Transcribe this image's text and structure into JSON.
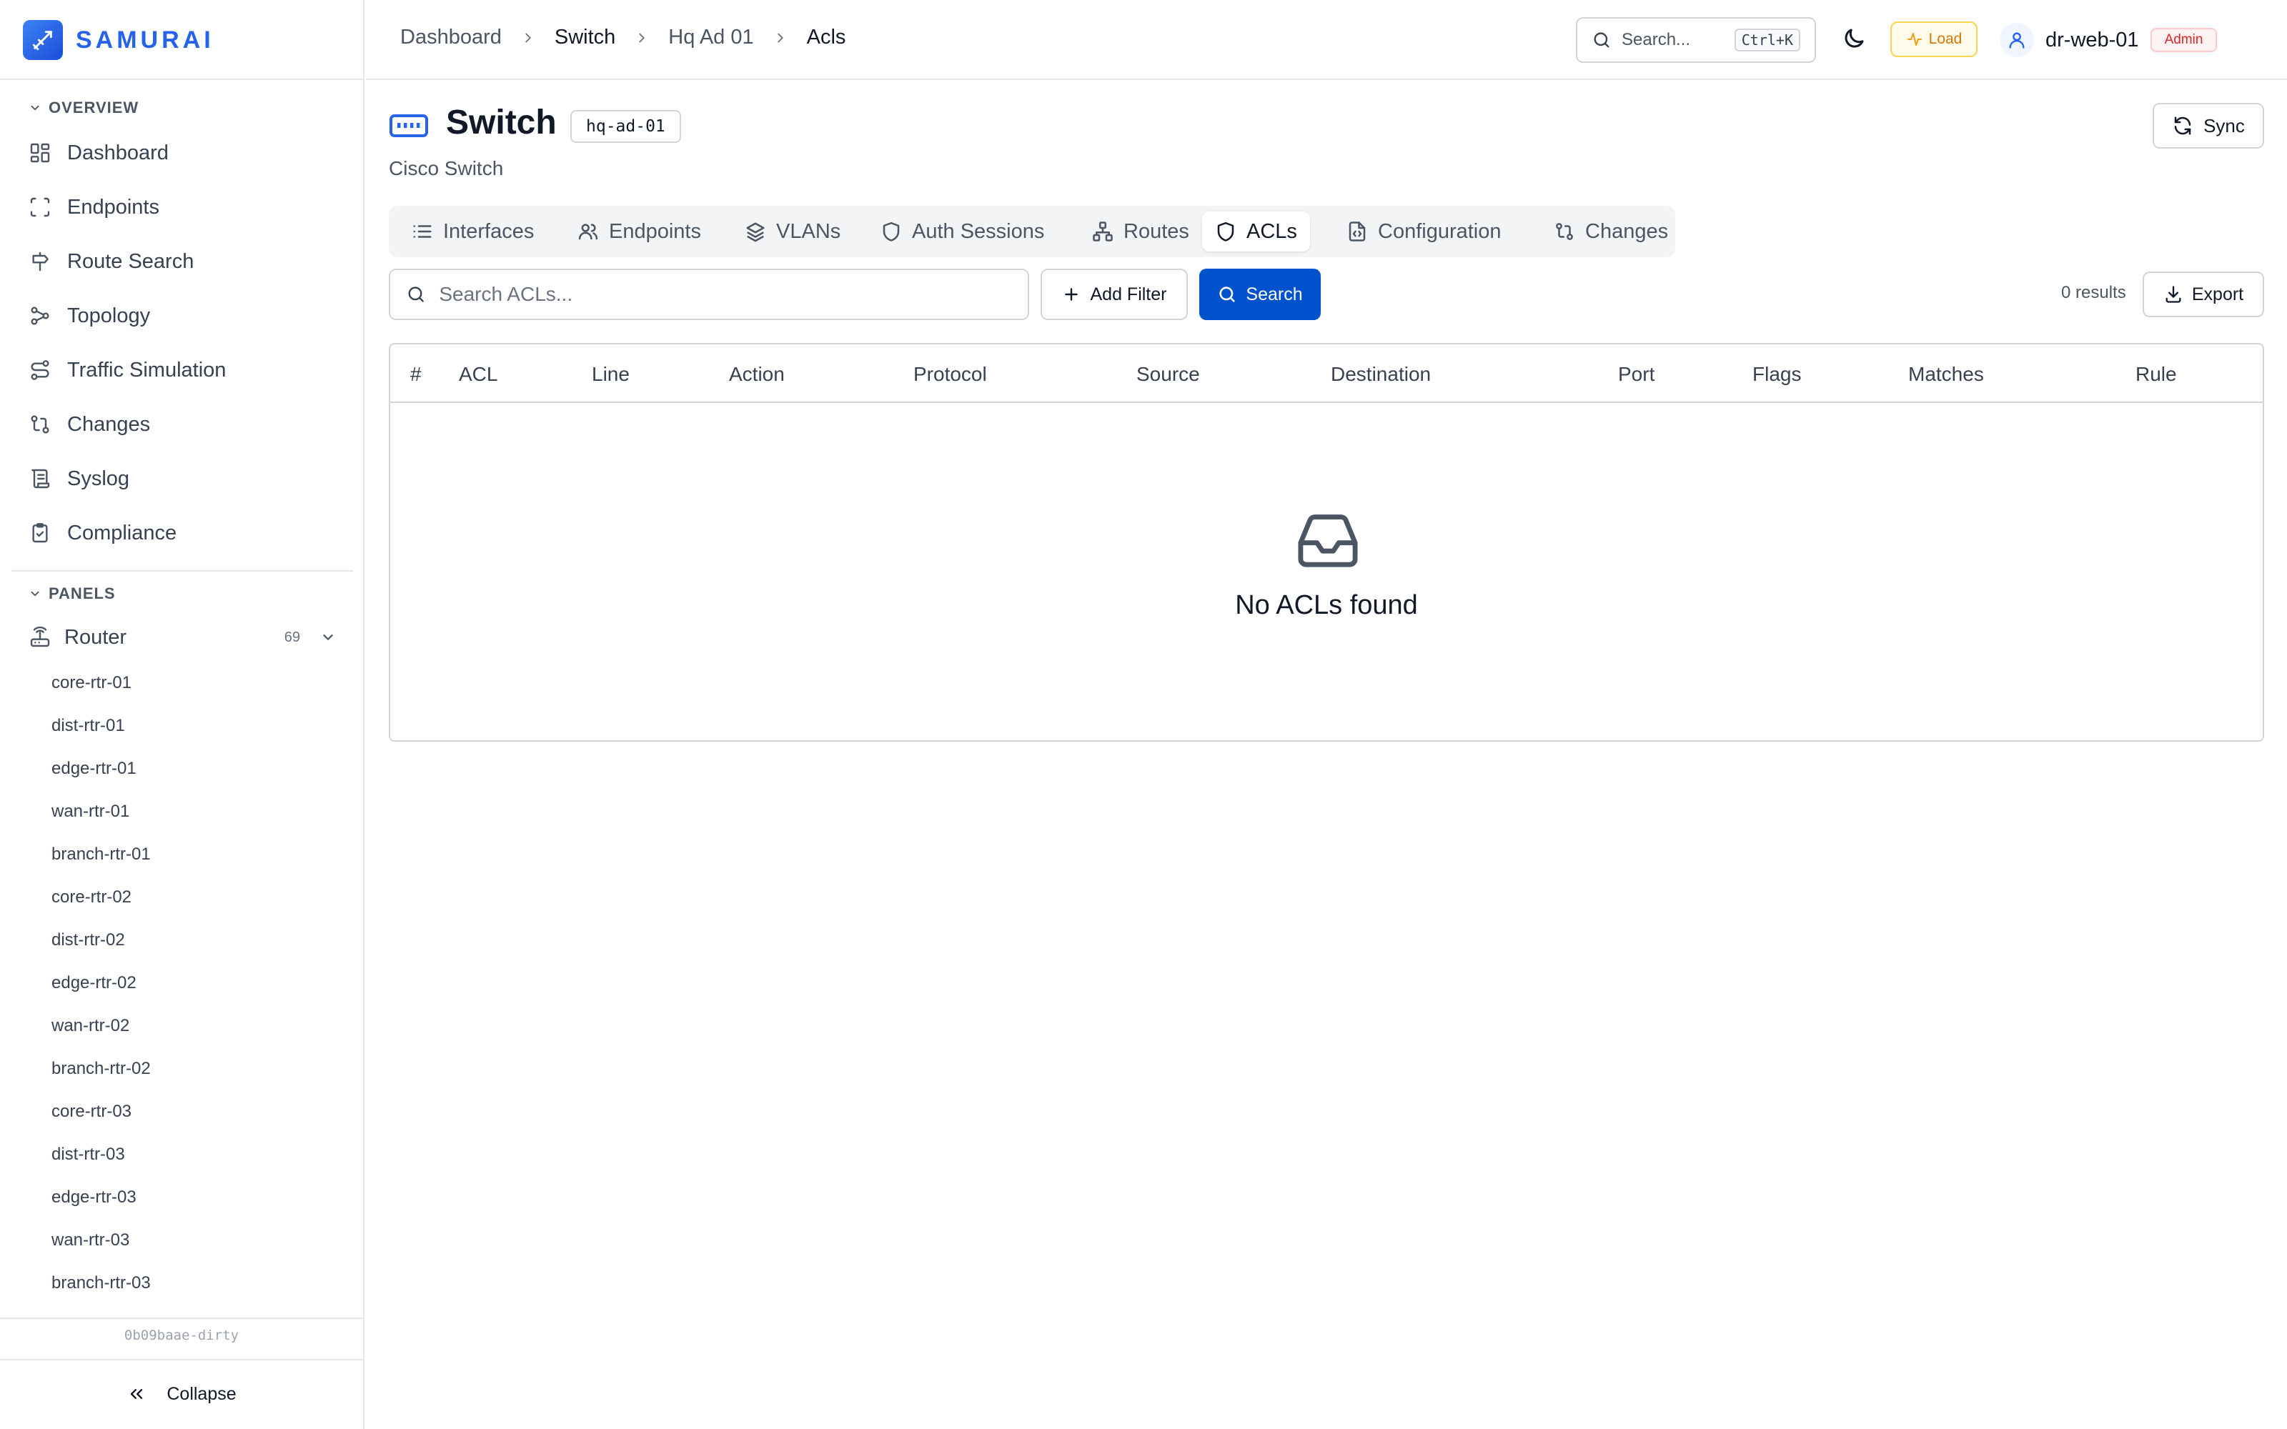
{
  "brand": {
    "name": "SAMURAI"
  },
  "sidebar": {
    "overview_label": "OVERVIEW",
    "nav": [
      {
        "label": "Dashboard",
        "icon": "grid-icon"
      },
      {
        "label": "Endpoints",
        "icon": "scan-icon"
      },
      {
        "label": "Route Search",
        "icon": "signpost-icon"
      },
      {
        "label": "Topology",
        "icon": "workflow-icon"
      },
      {
        "label": "Traffic Simulation",
        "icon": "route-icon"
      },
      {
        "label": "Changes",
        "icon": "git-compare-icon"
      },
      {
        "label": "Syslog",
        "icon": "scroll-icon"
      },
      {
        "label": "Compliance",
        "icon": "clipboard-check-icon"
      }
    ],
    "panels_label": "PANELS",
    "router_group": {
      "label": "Router",
      "count": "69"
    },
    "routers": [
      "core-rtr-01",
      "dist-rtr-01",
      "edge-rtr-01",
      "wan-rtr-01",
      "branch-rtr-01",
      "core-rtr-02",
      "dist-rtr-02",
      "edge-rtr-02",
      "wan-rtr-02",
      "branch-rtr-02",
      "core-rtr-03",
      "dist-rtr-03",
      "edge-rtr-03",
      "wan-rtr-03",
      "branch-rtr-03"
    ],
    "build_id": "0b09baae-dirty",
    "collapse_label": "Collapse"
  },
  "header": {
    "breadcrumb": [
      "Dashboard",
      "Switch",
      "Hq Ad 01",
      "Acls"
    ],
    "search_placeholder": "Search...",
    "search_shortcut": "Ctrl+K",
    "load_label": "Load",
    "username": "dr-web-01",
    "role": "Admin"
  },
  "page": {
    "title": "Switch",
    "hostname": "hq-ad-01",
    "subtitle": "Cisco Switch",
    "sync_label": "Sync"
  },
  "tabs": [
    {
      "label": "Interfaces",
      "icon": "list-icon",
      "active": false
    },
    {
      "label": "Endpoints",
      "icon": "users-icon",
      "active": false
    },
    {
      "label": "VLANs",
      "icon": "layers-icon",
      "active": false
    },
    {
      "label": "Auth Sessions",
      "icon": "shield-icon",
      "active": false
    },
    {
      "label": "Routes",
      "icon": "network-icon",
      "active": false
    },
    {
      "label": "ACLs",
      "icon": "shield-icon",
      "active": true
    },
    {
      "label": "Configuration",
      "icon": "file-code-icon",
      "active": false
    },
    {
      "label": "Changes",
      "icon": "git-compare-icon",
      "active": false
    }
  ],
  "toolbar": {
    "search_placeholder": "Search ACLs...",
    "add_filter_label": "Add Filter",
    "search_label": "Search",
    "results": "0 results",
    "export_label": "Export"
  },
  "table": {
    "columns": [
      "#",
      "ACL",
      "Line",
      "Action",
      "Protocol",
      "Source",
      "Destination",
      "Port",
      "Flags",
      "Matches",
      "Rule"
    ],
    "empty_message": "No ACLs found"
  },
  "colors": {
    "accent": "#2563eb",
    "primary_button": "#0052cc",
    "admin_badge": "#dc2626",
    "load_badge": "#d97706"
  }
}
